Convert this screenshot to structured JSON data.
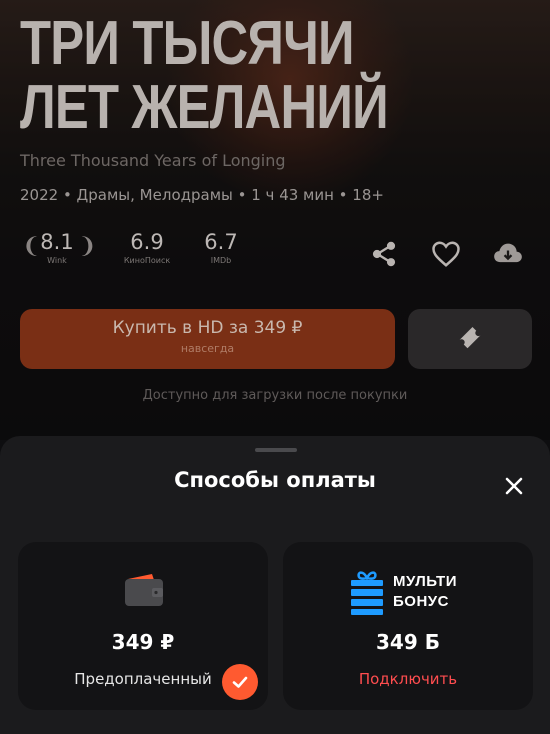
{
  "movie": {
    "title_line1": "ТРИ ТЫСЯЧИ",
    "title_line2": "ЛЕТ ЖЕЛАНИЙ",
    "original_title": "Three Thousand Years of Longing",
    "meta": "2022 • Драмы, Мелодрамы • 1 ч 43 мин • 18+",
    "ratings": [
      {
        "value": "8.1",
        "source": "Wink"
      },
      {
        "value": "6.9",
        "source": "КиноПоиск"
      },
      {
        "value": "6.7",
        "source": "IMDb"
      }
    ],
    "buy_label": "Купить в HD за 349 ₽",
    "buy_sublabel": "навсегда",
    "download_note": "Доступно для загрузки после покупки",
    "icons": [
      "share-icon",
      "heart-icon",
      "download-cloud-icon",
      "ticket-icon"
    ]
  },
  "payment_sheet": {
    "title": "Способы оплаты",
    "options": [
      {
        "price": "349 ₽",
        "label": "Предоплаченный",
        "icon": "wallet-icon",
        "selected": true
      },
      {
        "price": "349 Б",
        "label": "Подключить",
        "logo_line1": "МУЛЬТИ",
        "logo_line2": "БОНУС",
        "icon": "gift-icon"
      }
    ]
  },
  "colors": {
    "accent": "#ff5a30",
    "buy_button": "#7a2f15",
    "connect_link": "#ff4d4f",
    "bonus_blue": "#1e9bff"
  }
}
